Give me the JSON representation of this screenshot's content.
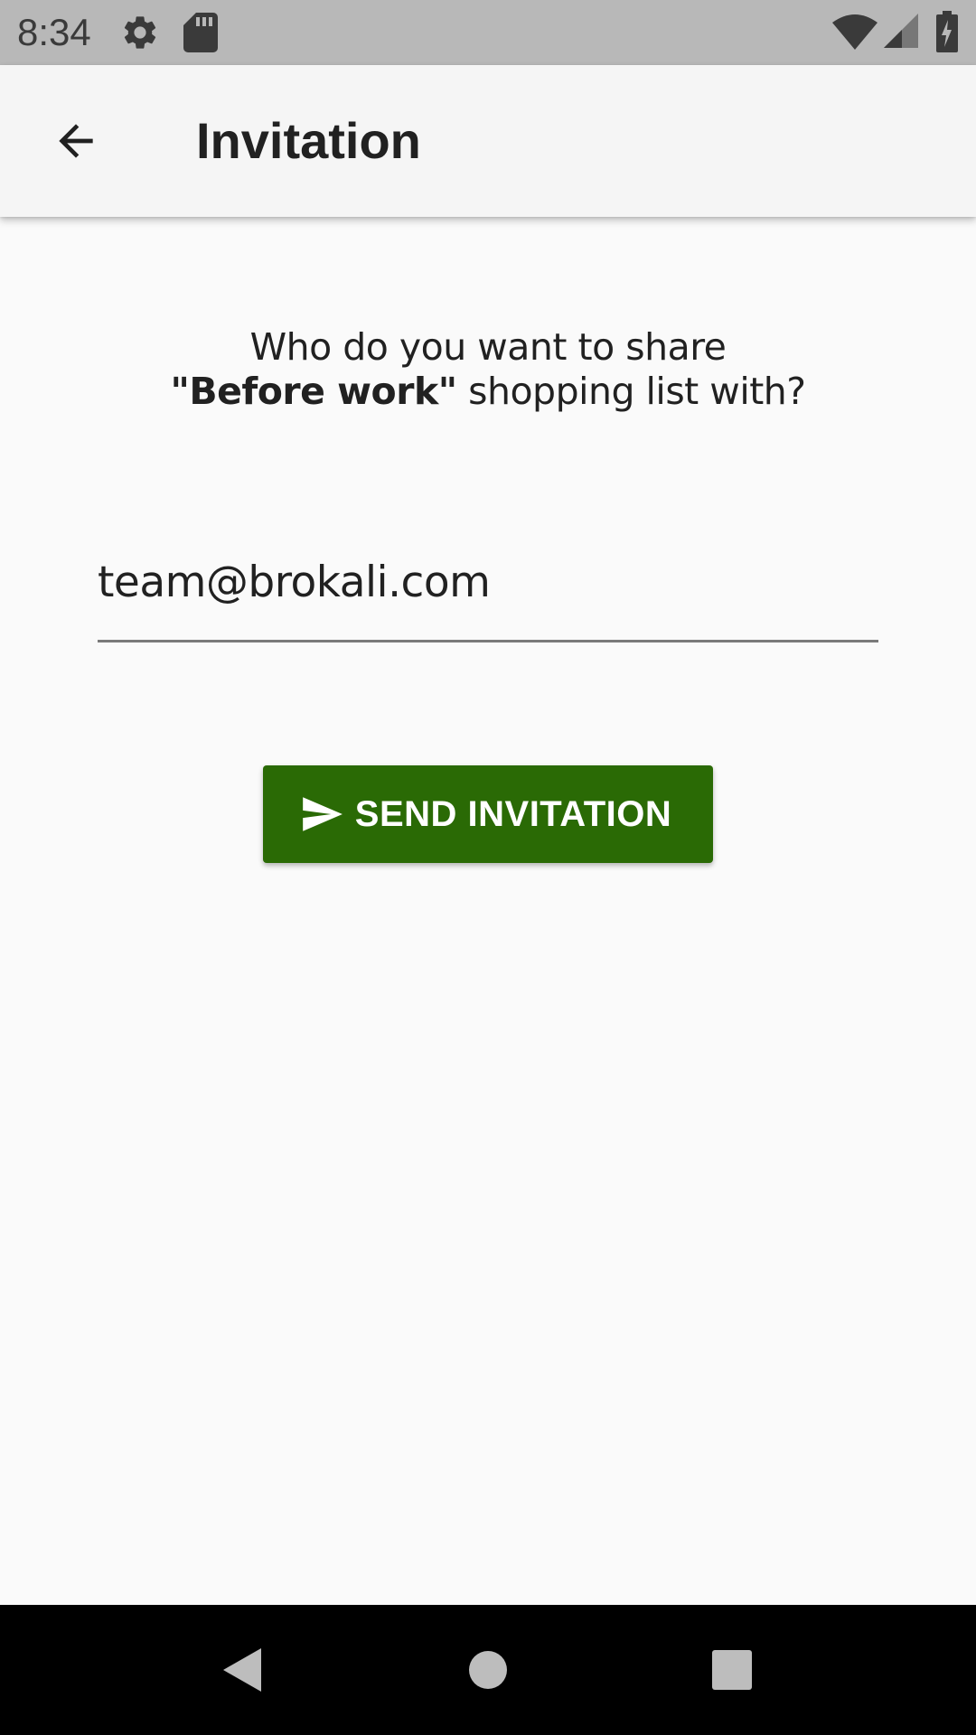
{
  "status_bar": {
    "time": "8:34",
    "icons": [
      "gear-icon",
      "sd-card-icon",
      "wifi-icon",
      "cellular-signal-icon",
      "battery-charging-icon"
    ]
  },
  "app_bar": {
    "title": "Invitation",
    "back_icon": "arrow-back-icon"
  },
  "prompt": {
    "line1": "Who do you want to share",
    "quote_open": "\"",
    "list_name": "Before work",
    "quote_close": "\"",
    "line2_rest": " shopping list with?"
  },
  "email_field": {
    "value": "team@brokali.com"
  },
  "send_button": {
    "label": "SEND INVITATION",
    "icon": "send-icon",
    "color": "#2a6a05"
  },
  "nav_bar": {
    "icons": [
      "nav-back-icon",
      "nav-home-icon",
      "nav-recents-icon"
    ]
  }
}
